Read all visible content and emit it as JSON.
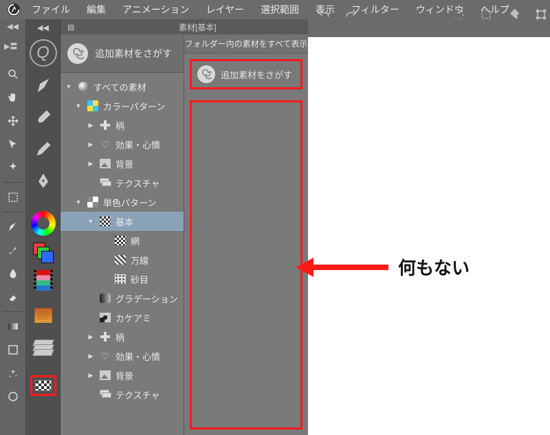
{
  "menubar": {
    "items": [
      "ファイル",
      "編集",
      "アニメーション",
      "レイヤー",
      "選択範囲",
      "表示",
      "フィルター",
      "ウィンドウ",
      "ヘルプ"
    ]
  },
  "panel": {
    "title": "素材[基本]"
  },
  "tree": {
    "header": "追加素材をさがす",
    "nodes": [
      {
        "label": "すべての素材",
        "icon": "sphere",
        "indent": 0,
        "arrow": "down"
      },
      {
        "label": "カラーパターン",
        "icon": "pinwheel",
        "indent": 1,
        "arrow": "down"
      },
      {
        "label": "柄",
        "icon": "cross",
        "indent": 2,
        "arrow": "right"
      },
      {
        "label": "効果・心情",
        "icon": "heart",
        "indent": 2,
        "arrow": "right"
      },
      {
        "label": "背景",
        "icon": "img",
        "indent": 2,
        "arrow": "right"
      },
      {
        "label": "テクスチャ",
        "icon": "stack",
        "indent": 2,
        "arrow": ""
      },
      {
        "label": "単色パターン",
        "icon": "pinwheel-mono",
        "indent": 1,
        "arrow": "down"
      },
      {
        "label": "基本",
        "icon": "checker",
        "indent": 2,
        "arrow": "down",
        "selected": true
      },
      {
        "label": "網",
        "icon": "checker",
        "indent": 3,
        "arrow": ""
      },
      {
        "label": "万線",
        "icon": "diag",
        "indent": 3,
        "arrow": ""
      },
      {
        "label": "砂目",
        "icon": "dots",
        "indent": 3,
        "arrow": ""
      },
      {
        "label": "グラデーション",
        "icon": "grad",
        "indent": 2,
        "arrow": ""
      },
      {
        "label": "カケアミ",
        "icon": "hatch",
        "indent": 2,
        "arrow": ""
      },
      {
        "label": "柄",
        "icon": "cross",
        "indent": 2,
        "arrow": "right"
      },
      {
        "label": "効果・心情",
        "icon": "heart",
        "indent": 2,
        "arrow": "right"
      },
      {
        "label": "背景",
        "icon": "img",
        "indent": 2,
        "arrow": "right"
      },
      {
        "label": "テクスチャ",
        "icon": "stack",
        "indent": 2,
        "arrow": ""
      }
    ]
  },
  "results": {
    "header": "フォルダー内の素材をすべて表示",
    "search": "追加素材をさがす"
  },
  "annotation": {
    "text": "何もない"
  },
  "top_icons": [
    "undo",
    "redo",
    "gap",
    "loading",
    "target",
    "bucket",
    "crop"
  ]
}
